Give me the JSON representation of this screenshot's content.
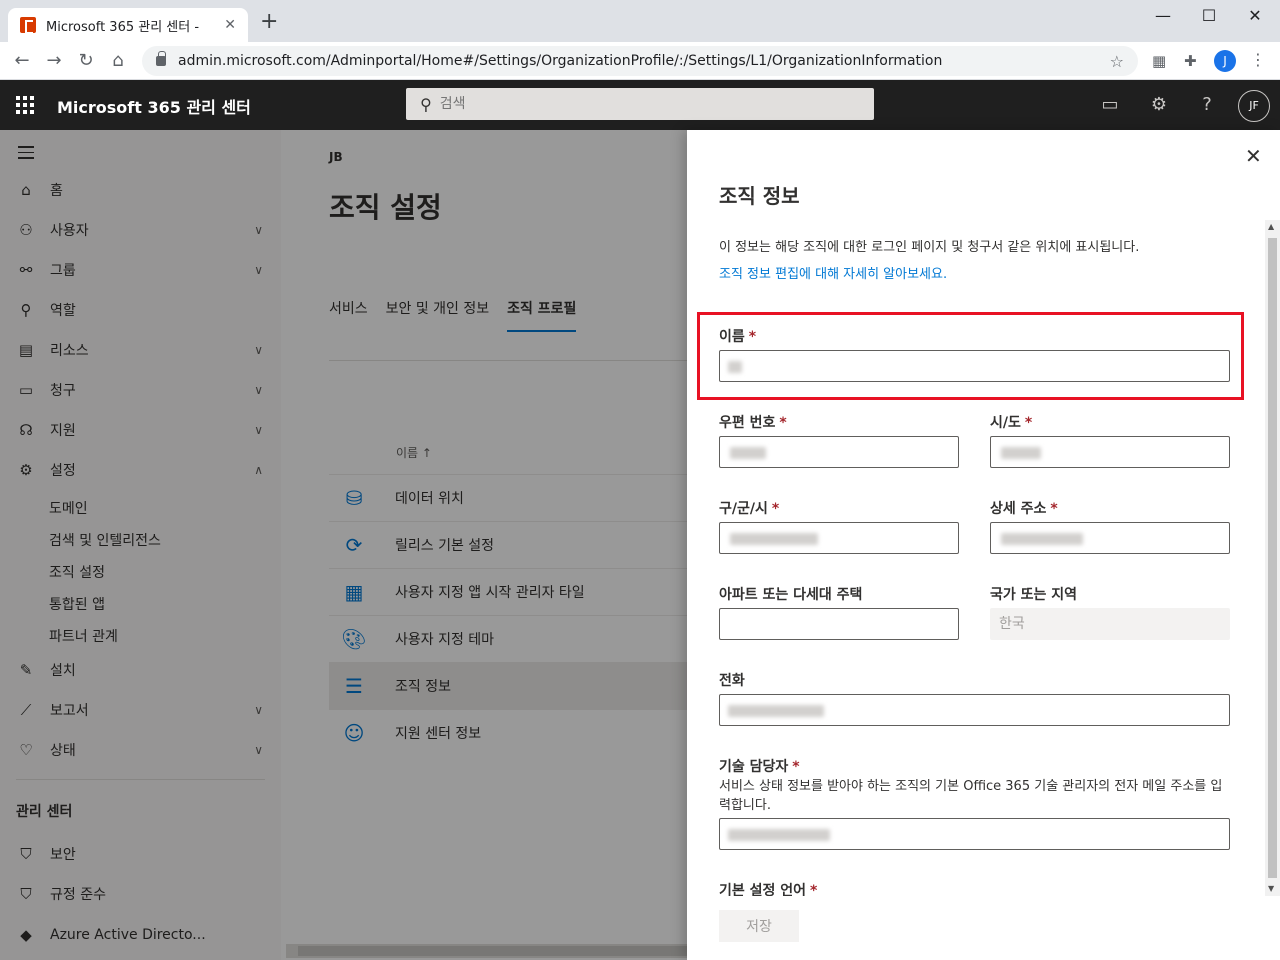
{
  "browser": {
    "tab_title": "Microsoft 365 관리 센터 -",
    "tab_close": "✕",
    "new_tab": "+",
    "url": "admin.microsoft.com/Adminportal/Home#/Settings/OrganizationProfile/:/Settings/L1/OrganizationInformation",
    "profile_initial": "J"
  },
  "header": {
    "app_title": "Microsoft 365 관리 센터",
    "search_placeholder": "검색",
    "avatar_initials": "JF"
  },
  "nav": {
    "items": [
      {
        "label": "홈",
        "icon": "home-icon"
      },
      {
        "label": "사용자",
        "icon": "user-icon"
      },
      {
        "label": "그룹",
        "icon": "group-icon"
      },
      {
        "label": "역할",
        "icon": "role-icon"
      },
      {
        "label": "리소스",
        "icon": "resource-icon"
      },
      {
        "label": "청구",
        "icon": "billing-icon"
      },
      {
        "label": "지원",
        "icon": "headset-icon"
      },
      {
        "label": "설정",
        "icon": "gear-icon"
      },
      {
        "label": "설치",
        "icon": "wrench-icon"
      },
      {
        "label": "보고서",
        "icon": "chart-icon"
      },
      {
        "label": "상태",
        "icon": "heart-icon"
      }
    ],
    "settings_sub": [
      "도메인",
      "검색 및 인텔리전스",
      "조직 설정",
      "통합된 앱",
      "파트너 관계"
    ],
    "admin_centers_heading": "관리 센터",
    "admin_centers": [
      "보안",
      "규정 준수",
      "Azure Active Directo..."
    ]
  },
  "main": {
    "breadcrumb": "JB",
    "title": "조직 설정",
    "tabs": [
      "서비스",
      "보안 및 개인 정보",
      "조직 프로필"
    ],
    "column_header": "이름 ↑",
    "rows": [
      "데이터 위치",
      "릴리스 기본 설정",
      "사용자 지정 앱 시작 관리자 타일",
      "사용자 지정 테마",
      "조직 정보",
      "지원 센터 정보"
    ]
  },
  "panel": {
    "title": "조직 정보",
    "description": "이 정보는 해당 조직에 대한 로그인 페이지 및 청구서 같은 위치에 표시됩니다.",
    "link": "조직 정보 편집에 대해 자세히 알아보세요.",
    "required_mark": "*",
    "fields": {
      "name": "이름",
      "postal": "우편 번호",
      "state": "시/도",
      "city": "구/군/시",
      "address": "상세 주소",
      "apartment": "아파트 또는 다세대 주택",
      "country": "국가 또는 지역",
      "country_value": "한국",
      "phone": "전화",
      "tech_contact": "기술 담당자",
      "tech_contact_desc": "서비스 상태 정보를 받아야 하는 조직의 기본 Office 365 기술 관리자의 전자 메일 주소를 입력합니다.",
      "language": "기본 설정 언어"
    },
    "save_label": "저장"
  }
}
